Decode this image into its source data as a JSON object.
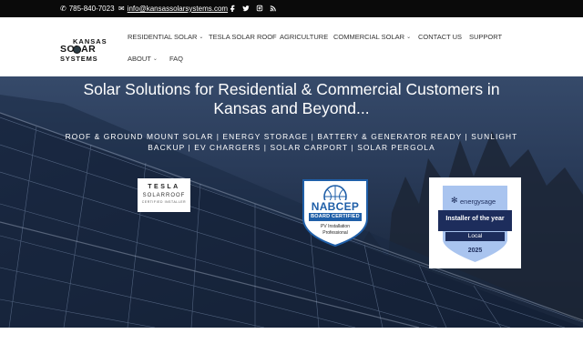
{
  "topbar": {
    "phone": "785-840-7023",
    "email": "info@kansassolarsystems.com",
    "social_icons": [
      "facebook-icon",
      "twitter-icon",
      "instagram-icon",
      "rss-icon"
    ]
  },
  "logo": {
    "line1": "KANSAS",
    "line2": "SOLAR",
    "line3": "SYSTEMS"
  },
  "nav": {
    "residential": "RESIDENTIAL SOLAR",
    "tesla": "TESLA SOLAR ROOF",
    "agriculture": "AGRICULTURE",
    "commercial": "COMMERCIAL SOLAR",
    "contact": "CONTACT US",
    "support": "SUPPORT",
    "about": "ABOUT",
    "faq": "FAQ"
  },
  "hero": {
    "title": "Solar Solutions for Residential & Commercial Customers in Kansas and Beyond...",
    "subtitle": "ROOF & GROUND MOUNT SOLAR | ENERGY STORAGE | BATTERY & GENERATOR READY  | SUNLIGHT BACKUP | EV CHARGERS | SOLAR CARPORT | SOLAR PERGOLA"
  },
  "badges": {
    "tesla": {
      "brand": "TESLA",
      "product": "SOLARROOF",
      "note": "CERTIFIED INSTALLER"
    },
    "nabcep": {
      "name": "NABCEP",
      "band": "BOARD CERTIFIED",
      "line1": "PV Installation",
      "line2": "Professional"
    },
    "energysage": {
      "brand": "energysage",
      "title": "Installer of the year",
      "scope": "Local",
      "year": "2025"
    }
  },
  "colors": {
    "topbar_bg": "#0a0a0a",
    "nabcep_blue": "#1f5fa8",
    "energysage_navy": "#1d2d5c",
    "energysage_light": "#a9c4ef"
  }
}
